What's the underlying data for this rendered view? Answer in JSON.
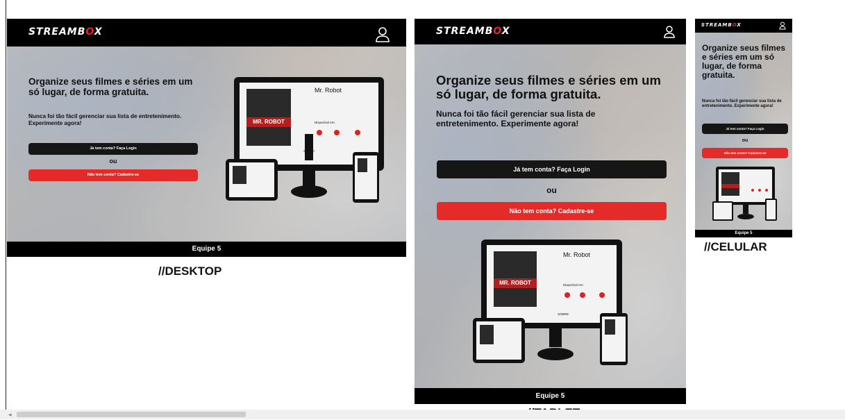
{
  "brand": {
    "name_prefix": "STREAMB",
    "name_accent": "O",
    "name_suffix": "X",
    "accent_color": "#e62325"
  },
  "hero": {
    "headline": "Organize seus filmes e séries em um só lugar, de forma gratuita.",
    "subtext": "Nunca foi tão fácil gerenciar sua lista de entretenimento. Experimente agora!",
    "login_button": "Já tem conta? Faça Login",
    "or_label": "ou",
    "signup_button": "Não tem conta? Cadastre-se"
  },
  "footer": {
    "label": "Equipe 5"
  },
  "captions": {
    "desktop": "//DESKTOP",
    "tablet": "//TABLET",
    "mobile": "//CELULAR"
  },
  "mockup": {
    "title": "Mr. Robot",
    "poster_text": "MR. ROBOT",
    "available_label": "Disponível em:",
    "about_label": "SOBRE:"
  },
  "icons": {
    "user": "user-icon",
    "scroll_left": "scroll-left-arrow"
  }
}
